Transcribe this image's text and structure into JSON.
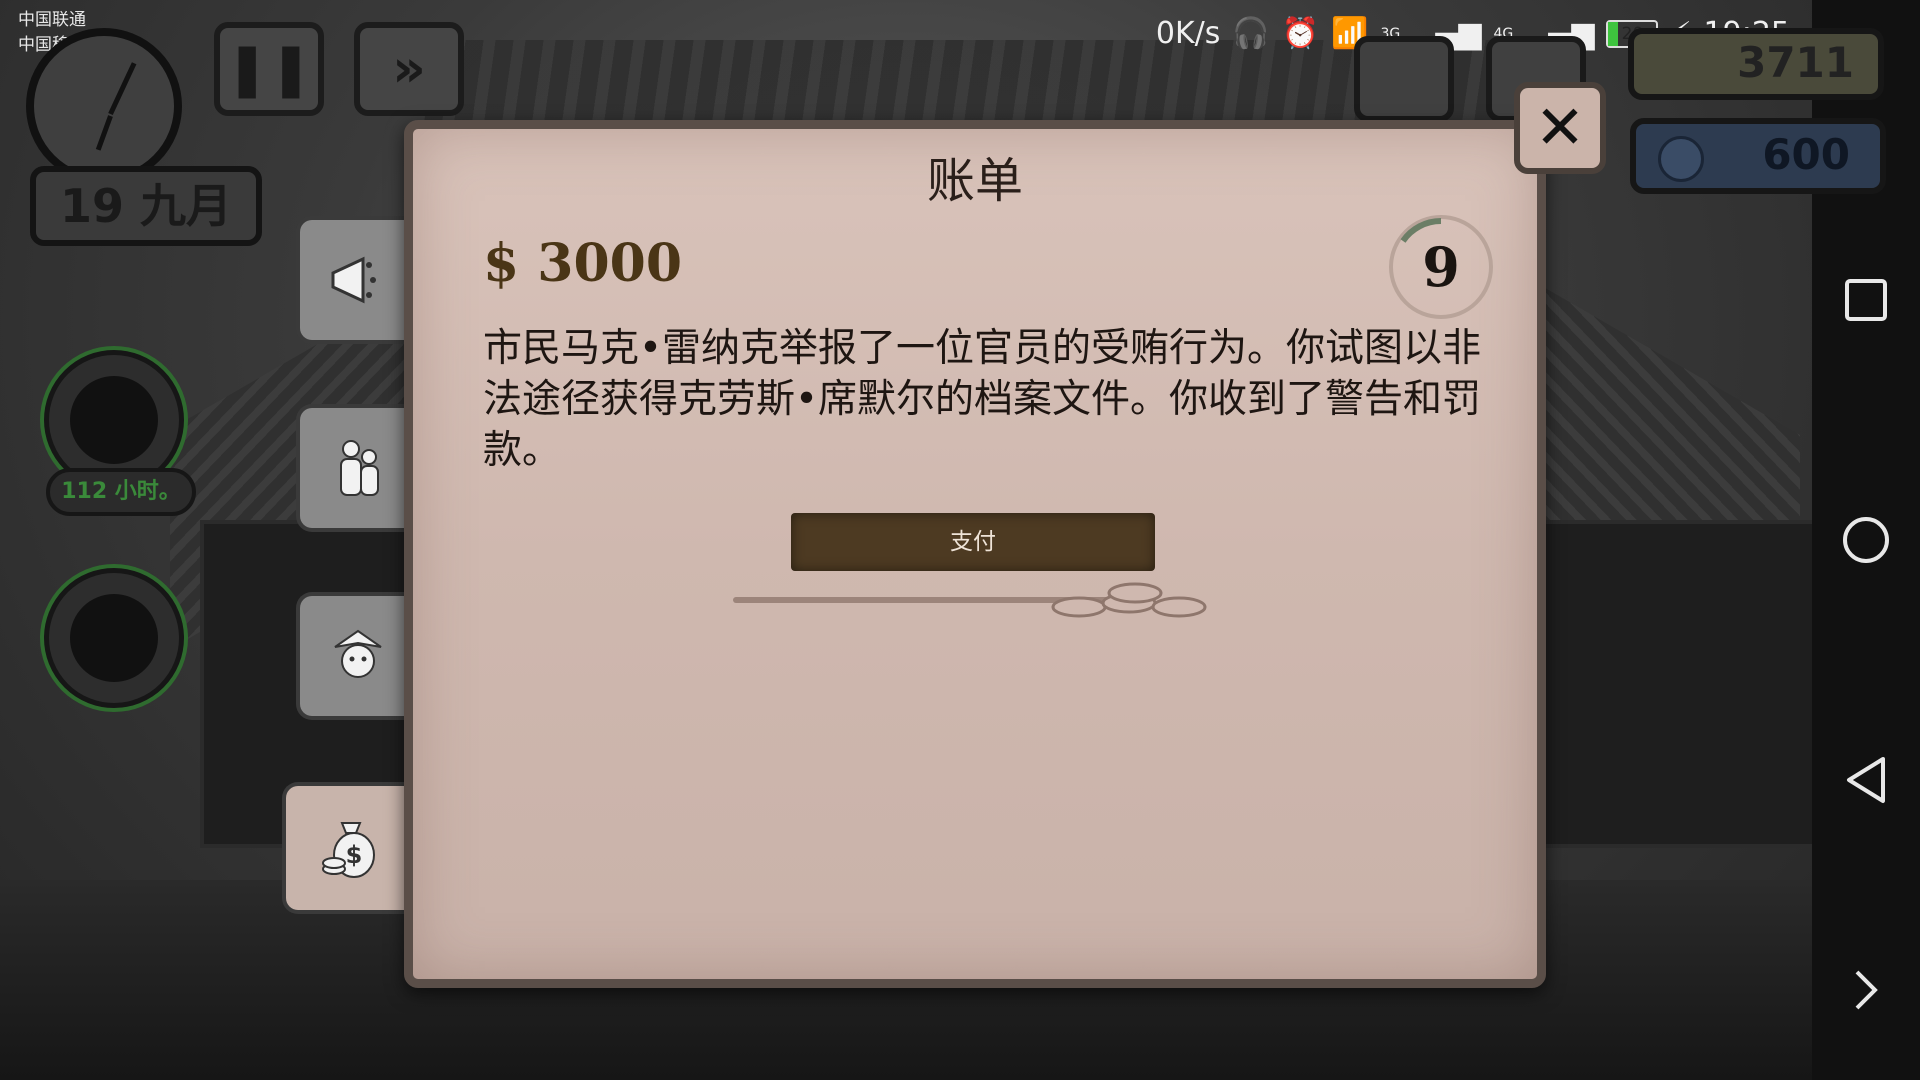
{
  "status_bar": {
    "carrier_1": "中国联通",
    "carrier_2": "中国移动",
    "net_speed": "0K/s",
    "network_3g": "3G",
    "network_4g": "4G",
    "battery": "20",
    "time": "19:25"
  },
  "hud": {
    "date": "19 九月",
    "money": "3711",
    "coins": "600",
    "hours_left": "112 小时。"
  },
  "modal": {
    "title": "账单",
    "amount": "$ 3000",
    "timer": "9",
    "message": "市民马克•雷纳克举报了一位官员的受贿行为。你试图以非法途径获得克劳斯•席默尔的档案文件。你收到了警告和罚款。",
    "pay_label": "支付"
  },
  "colors": {
    "modal_bg": "#d9c3ba",
    "pay_button": "#4d3a22",
    "amount_text": "#4a3516",
    "battery_green": "#3ec43e"
  }
}
